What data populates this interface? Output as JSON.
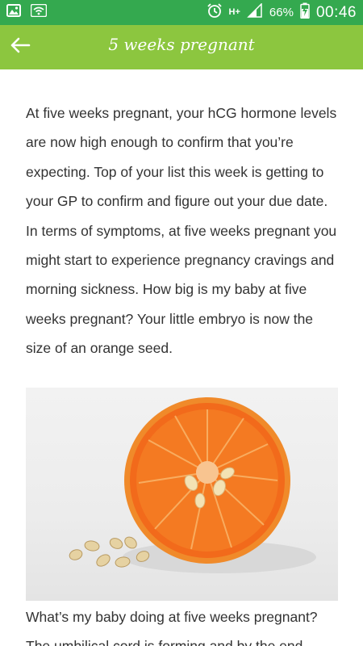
{
  "status_bar": {
    "network_type": "H+",
    "battery": "66%",
    "time": "00:46",
    "icons": [
      "gallery-icon",
      "wifi-icon",
      "alarm-icon",
      "signal-icon",
      "battery-charging-icon"
    ]
  },
  "app_bar": {
    "title": "5 weeks pregnant",
    "back_icon": "arrow-left-icon"
  },
  "article": {
    "paragraph_1": "At five weeks pregnant, your hCG hormone levels are now high enough to confirm that you’re expecting. Top of your list this week is getting to your GP to confirm and figure out your due date. In terms of symptoms, at five weeks pregnant you might start to experience pregnancy cravings and morning sickness. How big is my baby at five weeks pregnant? Your little embryo is now the size of an orange seed.",
    "image": "halved-orange-with-seeds-image",
    "paragraph_2_line_1": "What’s my baby doing at five weeks pregnant?",
    "paragraph_2_line_2": "The umbilical cord is forming and by the end"
  },
  "colors": {
    "status_bar": "#34a94f",
    "app_bar": "#8cc63f",
    "text": "#333333"
  }
}
